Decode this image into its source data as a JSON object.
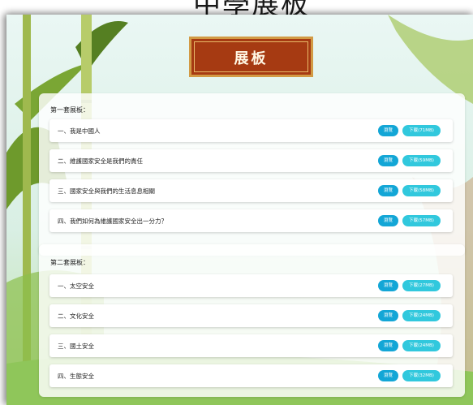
{
  "page": {
    "heading": "中學展板"
  },
  "banner": {
    "title": "展板"
  },
  "sets": [
    {
      "title": "第一套展板：",
      "items": [
        {
          "label": "一、我是中國人",
          "view": "瀏覽",
          "download": "下載(71MB)"
        },
        {
          "label": "二、維護國家安全是我們的責任",
          "view": "瀏覽",
          "download": "下載(59MB)"
        },
        {
          "label": "三、國家安全與我們的生活息息相關",
          "view": "瀏覽",
          "download": "下載(58MB)"
        },
        {
          "label": "四、我們如何為維護國家安全出一分力？",
          "view": "瀏覽",
          "download": "下載(57MB)"
        }
      ]
    },
    {
      "title": "第二套展板：",
      "items": [
        {
          "label": "一、太空安全",
          "view": "瀏覽",
          "download": "下載(27MB)"
        },
        {
          "label": "二、文化安全",
          "view": "瀏覽",
          "download": "下載(24MB)"
        },
        {
          "label": "三、國土安全",
          "view": "瀏覽",
          "download": "下載(24MB)"
        },
        {
          "label": "四、生態安全",
          "view": "瀏覽",
          "download": "下載(32MB)"
        }
      ]
    }
  ],
  "colors": {
    "view_button": "#13a6d6",
    "download_button": "#31c8dd",
    "banner": "#a63a12"
  }
}
